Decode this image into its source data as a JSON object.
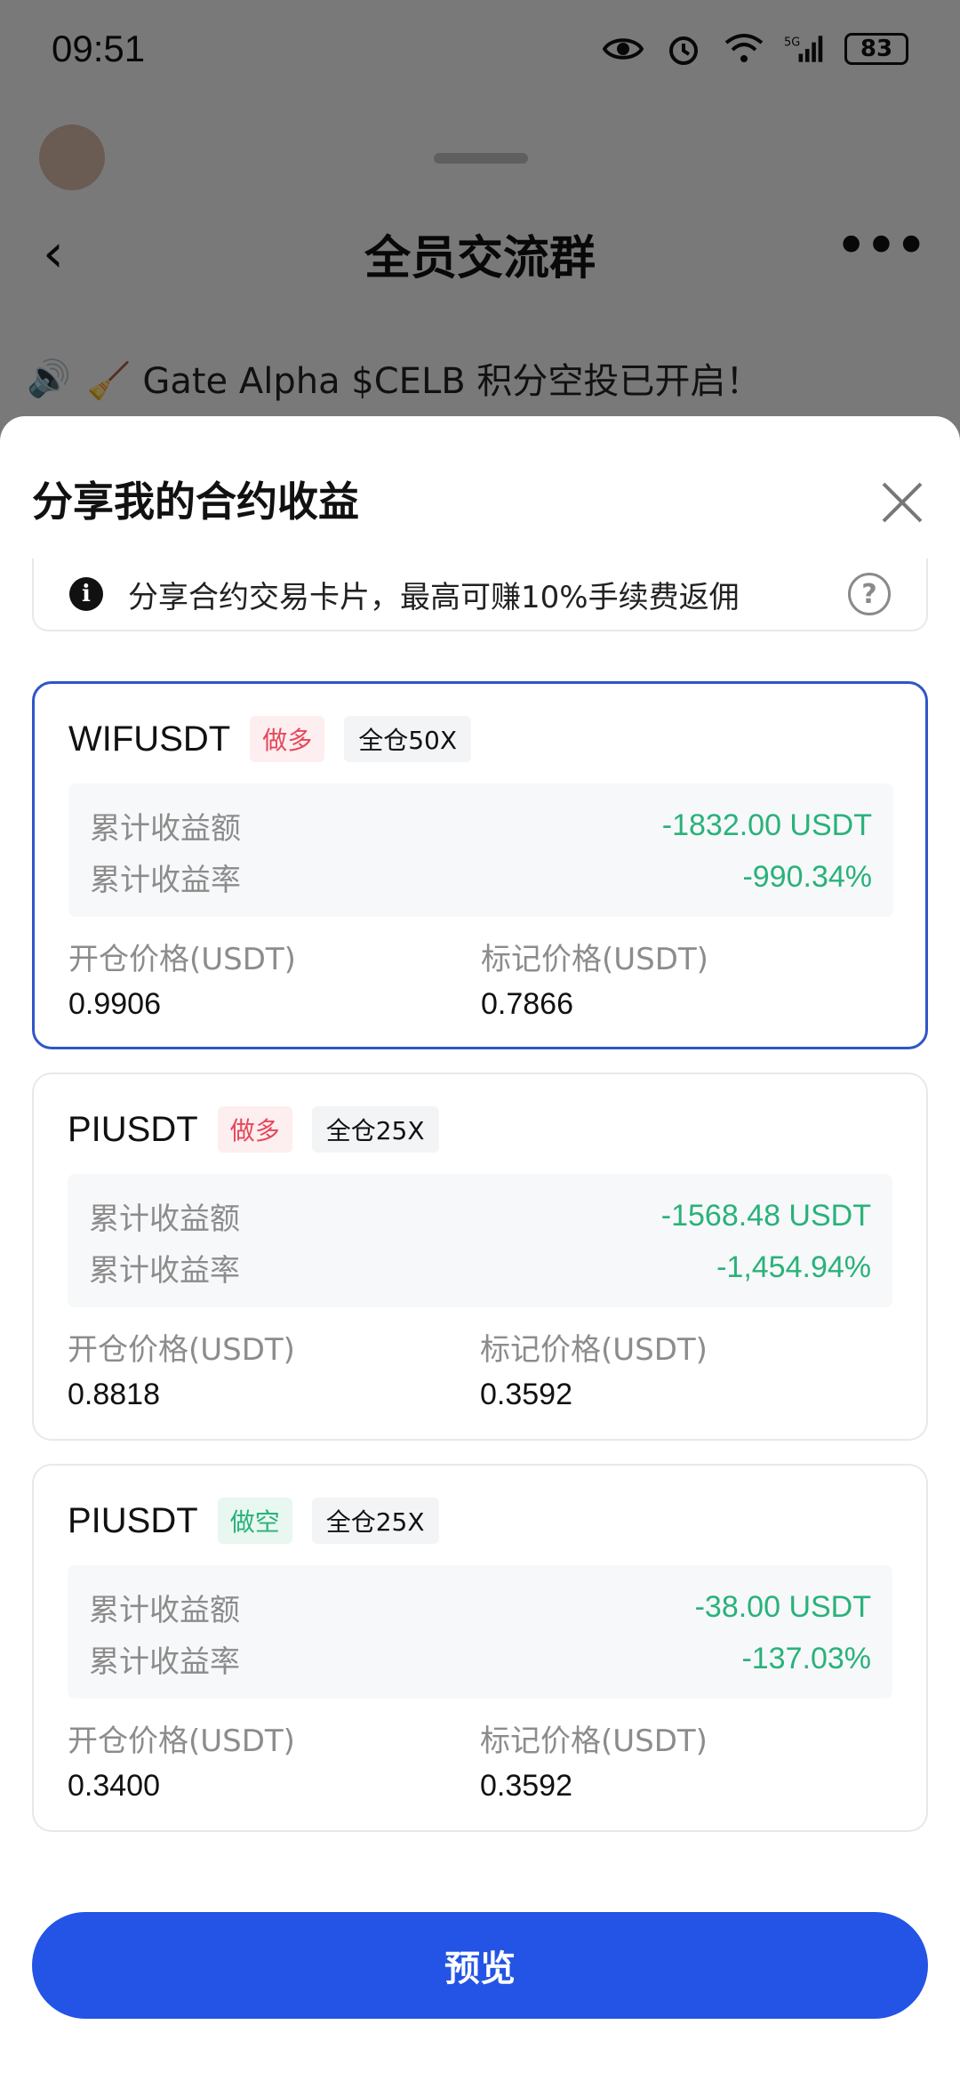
{
  "status_bar": {
    "time": "09:51",
    "battery": "83",
    "network": "5G"
  },
  "chat": {
    "back_icon": "back-arrow-icon",
    "title": "全员交流群",
    "more_icon": "more-dots-icon",
    "announcement": "🧹 Gate Alpha $CELB 积分空投已开启！"
  },
  "sheet": {
    "title": "分享我的合约收益",
    "info_text": "分享合约交易卡片，最高可赚10%手续费返佣",
    "preview_label": "预览"
  },
  "labels": {
    "cum_pnl": "累计收益额",
    "cum_pnl_rate": "累计收益率",
    "open_price": "开仓价格(USDT)",
    "mark_price": "标记价格(USDT)"
  },
  "positions": [
    {
      "symbol": "WIFUSDT",
      "side": "做多",
      "leverage": "全仓50X",
      "pnl": "-1832.00 USDT",
      "pnl_rate": "-990.34%",
      "open_price": "0.9906",
      "mark_price": "0.7866"
    },
    {
      "symbol": "PIUSDT",
      "side": "做多",
      "leverage": "全仓25X",
      "pnl": "-1568.48 USDT",
      "pnl_rate": "-1,454.94%",
      "open_price": "0.8818",
      "mark_price": "0.3592"
    },
    {
      "symbol": "PIUSDT",
      "side": "做空",
      "leverage": "全仓25X",
      "pnl": "-38.00 USDT",
      "pnl_rate": "-137.03%",
      "open_price": "0.3400",
      "mark_price": "0.3592"
    }
  ],
  "colors": {
    "accent": "#2354e6",
    "long": "#e5485b",
    "short": "#29b27a",
    "pnl_text": "#29b27a",
    "selected_border": "#2f55c8"
  }
}
